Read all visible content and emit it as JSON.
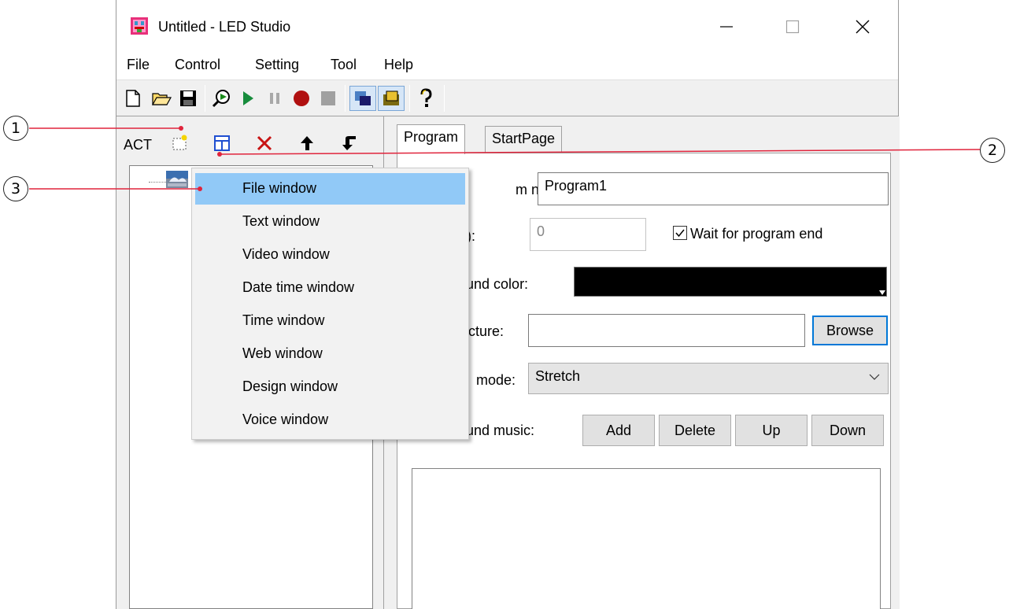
{
  "window": {
    "title": "Untitled - LED Studio"
  },
  "menu": [
    "File",
    "Control",
    "Setting",
    "Tool",
    "Help"
  ],
  "toolbar": {
    "icons": [
      "new-file-icon",
      "open-folder-icon",
      "save-icon",
      "preview-icon",
      "play-icon",
      "pause-icon",
      "record-icon",
      "stop-icon",
      "window-mode-icon",
      "screen-mode-icon",
      "help-icon"
    ]
  },
  "left_panel": {
    "act_label": "ACT",
    "icons": [
      "add-program-icon",
      "add-window-icon",
      "delete-icon",
      "move-up-icon",
      "move-down-icon"
    ]
  },
  "tabs": [
    "Program",
    "StartPage"
  ],
  "program_tab": {
    "name_label": "m name:",
    "name_value": "Program1",
    "time_label": "):",
    "time_value": "0",
    "wait_label": "Wait for program end",
    "wait_checked": true,
    "bg_color_label": "ound color:",
    "bg_color": "#000000",
    "picture_label": "cture:",
    "picture_value": "",
    "browse_label": "Browse",
    "mode_label": "mode:",
    "mode_value": "Stretch",
    "music_label": "ound music:",
    "music_buttons": [
      "Add",
      "Delete",
      "Up",
      "Down"
    ]
  },
  "context_menu": {
    "items": [
      "File window",
      "Text window",
      "Video window",
      "Date time window",
      "Time window",
      "Web window",
      "Design window",
      "Voice window"
    ],
    "highlighted_index": 0
  },
  "callouts": [
    "1",
    "2",
    "3"
  ],
  "colors": {
    "callout_line": "#e0243c",
    "highlight": "#91c9f7",
    "accent": "#0078d7"
  }
}
